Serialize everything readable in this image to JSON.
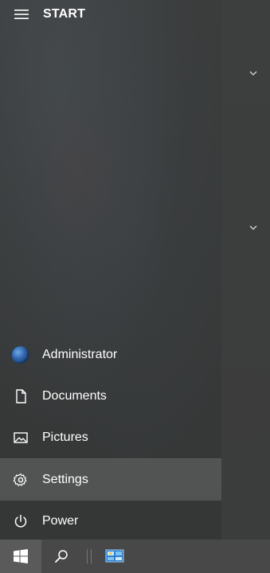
{
  "start_menu": {
    "title": "START",
    "items": [
      {
        "label": "Administrator",
        "icon": "user-avatar"
      },
      {
        "label": "Documents",
        "icon": "document-icon"
      },
      {
        "label": "Pictures",
        "icon": "pictures-icon"
      },
      {
        "label": "Settings",
        "icon": "gear-icon"
      },
      {
        "label": "Power",
        "icon": "power-icon"
      }
    ],
    "active_item": "Settings"
  },
  "taskbar": {
    "start_icon": "windows-logo-icon",
    "search_icon": "search-icon",
    "pinned_app_icon": "control-panel-icon"
  },
  "colors": {
    "text": "#ffffff",
    "active_item_bg": "rgba(255,255,255,0.14)",
    "taskbar_bg": "#474847",
    "accent_blue": "#3aa0e8"
  }
}
